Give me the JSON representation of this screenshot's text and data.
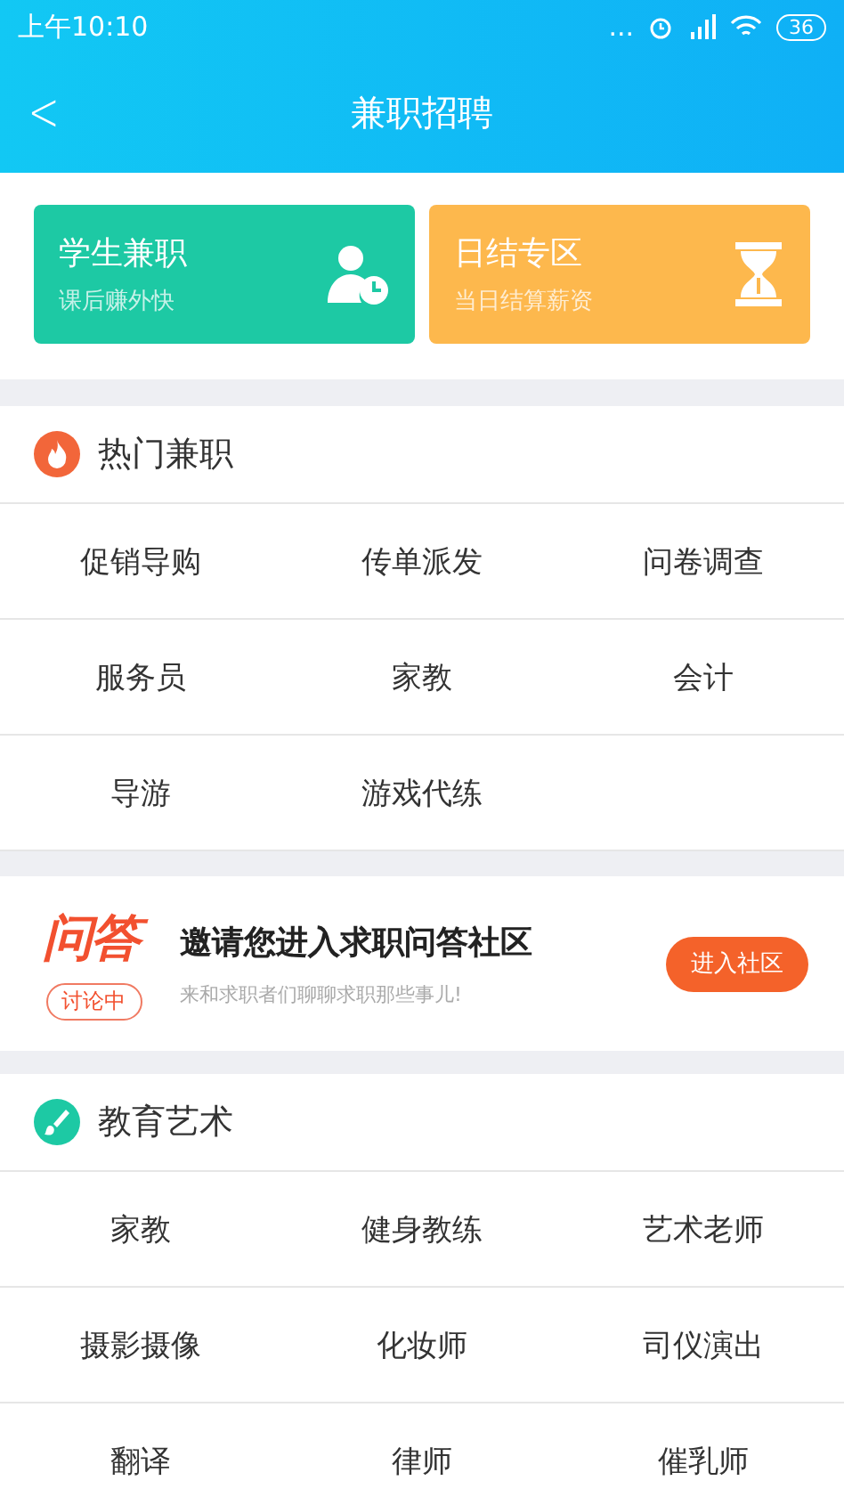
{
  "status_bar": {
    "time": "上午10:10",
    "indicators": "...",
    "battery": "36"
  },
  "header": {
    "back": "<",
    "title": "兼职招聘"
  },
  "feature_cards": [
    {
      "kind": "student",
      "title": "学生兼职",
      "subtitle": "课后赚外快",
      "color": "#1dc9a4"
    },
    {
      "kind": "daily",
      "title": "日结专区",
      "subtitle": "当日结算薪资",
      "color": "#fdb84d"
    }
  ],
  "sections": [
    {
      "kind": "hot",
      "title": "热门兼职",
      "items": [
        "促销导购",
        "传单派发",
        "问卷调查",
        "服务员",
        "家教",
        "会计",
        "导游",
        "游戏代练"
      ]
    },
    {
      "kind": "banner",
      "logo": "问答",
      "badge": "讨论中",
      "headline": "邀请您进入求职问答社区",
      "subline": "来和求职者们聊聊求职那些事儿!",
      "button": "进入社区"
    },
    {
      "kind": "education",
      "title": "教育艺术",
      "items": [
        "家教",
        "健身教练",
        "艺术老师",
        "摄影摄像",
        "化妆师",
        "司仪演出",
        "翻译",
        "律师",
        "催乳师"
      ]
    }
  ]
}
